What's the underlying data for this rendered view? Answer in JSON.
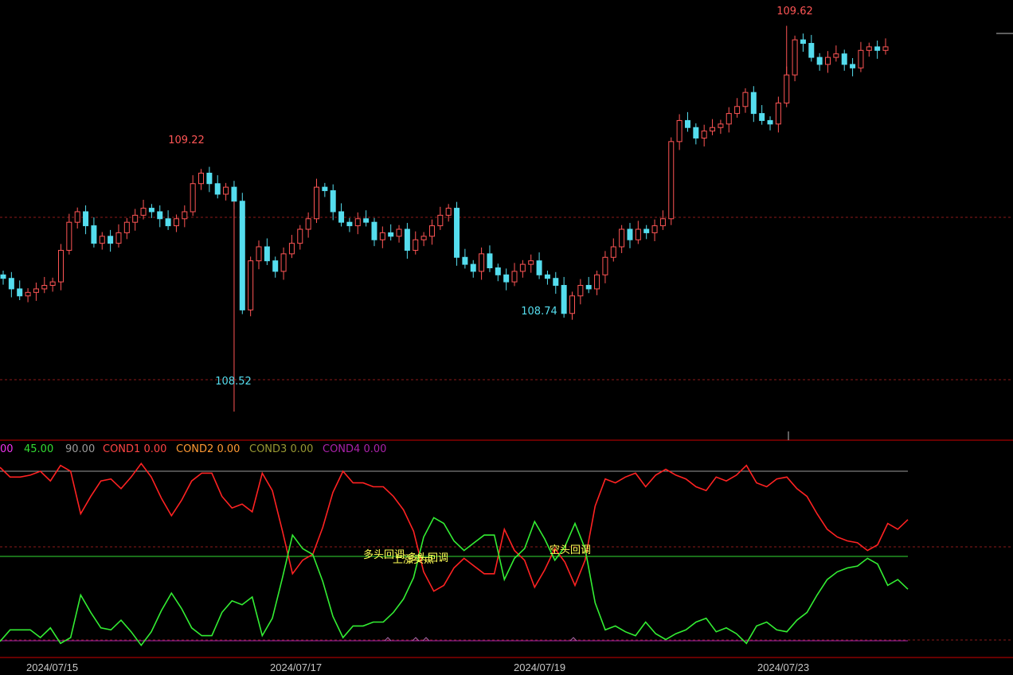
{
  "chart_data": [
    {
      "type": "candlestick",
      "panel": "price",
      "ylim": [
        108.45,
        109.68
      ],
      "annotations": [
        {
          "label": "109.62",
          "value": 109.62,
          "color": "#ff5555"
        },
        {
          "label": "109.22",
          "value": 109.22,
          "color": "#ff5555"
        },
        {
          "label": "108.74",
          "value": 108.74,
          "color": "#55ddee"
        },
        {
          "label": "108.52",
          "value": 108.52,
          "color": "#55ddee"
        }
      ],
      "reference_lines": [
        109.0,
        108.62
      ],
      "series": [
        {
          "name": "close",
          "values": [
            108.9,
            108.87,
            108.85,
            108.86,
            108.87,
            108.88,
            108.89,
            108.98,
            109.06,
            109.09,
            109.05,
            109.0,
            109.02,
            109.0,
            109.03,
            109.06,
            109.08,
            109.1,
            109.09,
            109.07,
            109.05,
            109.07,
            109.09,
            109.17,
            109.2,
            109.17,
            109.14,
            109.16,
            109.12,
            108.81,
            108.95,
            108.99,
            108.95,
            108.92,
            108.97,
            109.0,
            109.04,
            109.07,
            109.16,
            109.15,
            109.09,
            109.06,
            109.05,
            109.07,
            109.06,
            109.01,
            109.03,
            109.02,
            109.04,
            108.98,
            109.01,
            109.02,
            109.05,
            109.08,
            109.1,
            108.96,
            108.94,
            108.92,
            108.97,
            108.93,
            108.91,
            108.89,
            108.92,
            108.94,
            108.95,
            108.91,
            108.9,
            108.88,
            108.8,
            108.85,
            108.88,
            108.87,
            108.91,
            108.96,
            108.99,
            109.04,
            109.01,
            109.04,
            109.03,
            109.05,
            109.07,
            109.29,
            109.35,
            109.33,
            109.3,
            109.32,
            109.33,
            109.34,
            109.37,
            109.39,
            109.43,
            109.37,
            109.35,
            109.34,
            109.4,
            109.48,
            109.58,
            109.57,
            109.53,
            109.51,
            109.53,
            109.54,
            109.51,
            109.5,
            109.55,
            109.56,
            109.55,
            109.56
          ]
        }
      ]
    },
    {
      "type": "line",
      "panel": "indicator",
      "ylim": [
        0,
        100
      ],
      "reference_lines": [
        90.0,
        45.0,
        10.0
      ],
      "series": [
        {
          "name": "red",
          "color": "#ff2222",
          "values": [
            95,
            90,
            90,
            91,
            93,
            88,
            96,
            93,
            71,
            80,
            88,
            89,
            84,
            90,
            97,
            90,
            79,
            70,
            78,
            88,
            92,
            92,
            80,
            74,
            76,
            72,
            92,
            83,
            62,
            40,
            47,
            50,
            64,
            82,
            93,
            87,
            87,
            85,
            85,
            80,
            73,
            62,
            41,
            31,
            34,
            43,
            48,
            44,
            40,
            40,
            63,
            52,
            47,
            33,
            42,
            53,
            46,
            34,
            47,
            75,
            89,
            87,
            90,
            92,
            85,
            91,
            94,
            91,
            89,
            85,
            83,
            90,
            88,
            91,
            96,
            87,
            85,
            89,
            90,
            84,
            80,
            71,
            63,
            59,
            57,
            56,
            52,
            55,
            66,
            63,
            68
          ]
        },
        {
          "name": "green",
          "color": "#33ee33",
          "values": [
            5,
            11,
            11,
            11,
            7,
            12,
            4,
            7,
            29,
            20,
            12,
            11,
            16,
            10,
            3,
            10,
            21,
            30,
            22,
            12,
            8,
            8,
            20,
            26,
            24,
            28,
            8,
            17,
            38,
            60,
            53,
            50,
            36,
            18,
            7,
            13,
            13,
            15,
            15,
            20,
            27,
            38,
            59,
            69,
            66,
            57,
            52,
            56,
            60,
            60,
            37,
            48,
            53,
            67,
            58,
            47,
            54,
            66,
            53,
            25,
            11,
            13,
            10,
            8,
            15,
            9,
            6,
            9,
            11,
            15,
            17,
            10,
            12,
            9,
            4,
            13,
            15,
            11,
            10,
            16,
            20,
            29,
            37,
            41,
            43,
            44,
            48,
            45,
            34,
            37,
            32
          ]
        }
      ],
      "signals": [
        {
          "label": "多头回调"
        },
        {
          "label": "上涨卖点"
        },
        {
          "label": "多头回调"
        },
        {
          "label": "空头回调"
        }
      ]
    }
  ],
  "legend": {
    "items": [
      {
        "label": "00",
        "color": "#ee33ee"
      },
      {
        "label": "45.00",
        "color": "#33dd33"
      },
      {
        "label": "90.00",
        "color": "#9a9a9a"
      },
      {
        "label": "COND1 0.00",
        "color": "#ff4444"
      },
      {
        "label": "COND2 0.00",
        "color": "#ff9933"
      },
      {
        "label": "COND3 0.00",
        "color": "#999933"
      },
      {
        "label": "COND4 0.00",
        "color": "#aa22aa"
      }
    ]
  },
  "x_axis": {
    "labels": [
      "2024/07/15",
      "2024/07/17",
      "2024/07/19",
      "2024/07/23"
    ]
  },
  "colors": {
    "up": "#ff5555",
    "down": "#55ddee",
    "border": "#cc0000",
    "grid_dashed": "#8b1a1a"
  }
}
